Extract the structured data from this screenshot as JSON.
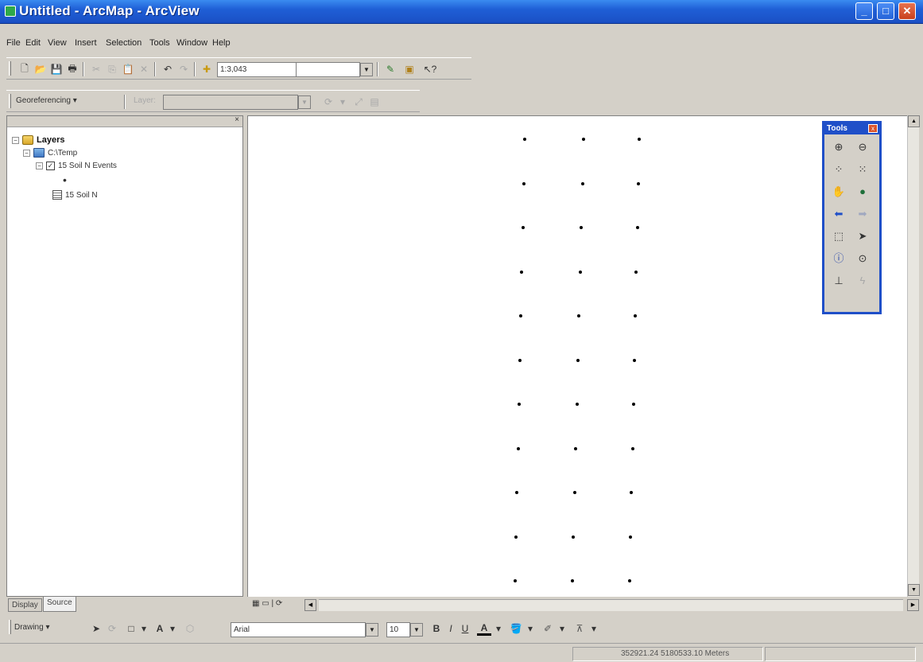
{
  "window": {
    "title": "Untitled - ArcMap - ArcView",
    "minimize_glyph": "_",
    "maximize_glyph": "□",
    "close_glyph": "✕"
  },
  "menu": [
    "File",
    "Edit",
    "View",
    "Insert",
    "Selection",
    "Tools",
    "Window",
    "Help"
  ],
  "standard_toolbar": {
    "scale_value": "1:3,043",
    "buttons": [
      "new-icon",
      "open-icon",
      "save-icon",
      "print-icon",
      "cut-icon",
      "copy-icon",
      "paste-icon",
      "delete-icon",
      "undo-icon",
      "redo-icon",
      "add-data-icon",
      "editor-icon",
      "arctoolbox-icon",
      "whats-this-icon"
    ]
  },
  "georef_toolbar": {
    "label": "Georeferencing ▾",
    "layer_label": "Layer:",
    "layer_value": ""
  },
  "toc": {
    "layers": "Layers",
    "workspace": "C:\\Temp",
    "event_layer": "15 Soil N Events",
    "point_symbol": "•",
    "table": "15 Soil N",
    "expand_minus": "−",
    "check": "✓"
  },
  "tabs": {
    "display": "Display",
    "source": "Source"
  },
  "map": {
    "rows": 11,
    "cols": 3
  },
  "tools_toolbar": {
    "title": "Tools",
    "close": "x"
  },
  "drawing_toolbar": {
    "label": "Drawing ▾",
    "font_value": "Arial",
    "size_value": "10",
    "bold": "B",
    "italic": "I",
    "underline": "U",
    "font_color": "A",
    "text_tool": "A"
  },
  "status": {
    "coordinates": "352921.24  5180533.10 Meters"
  }
}
